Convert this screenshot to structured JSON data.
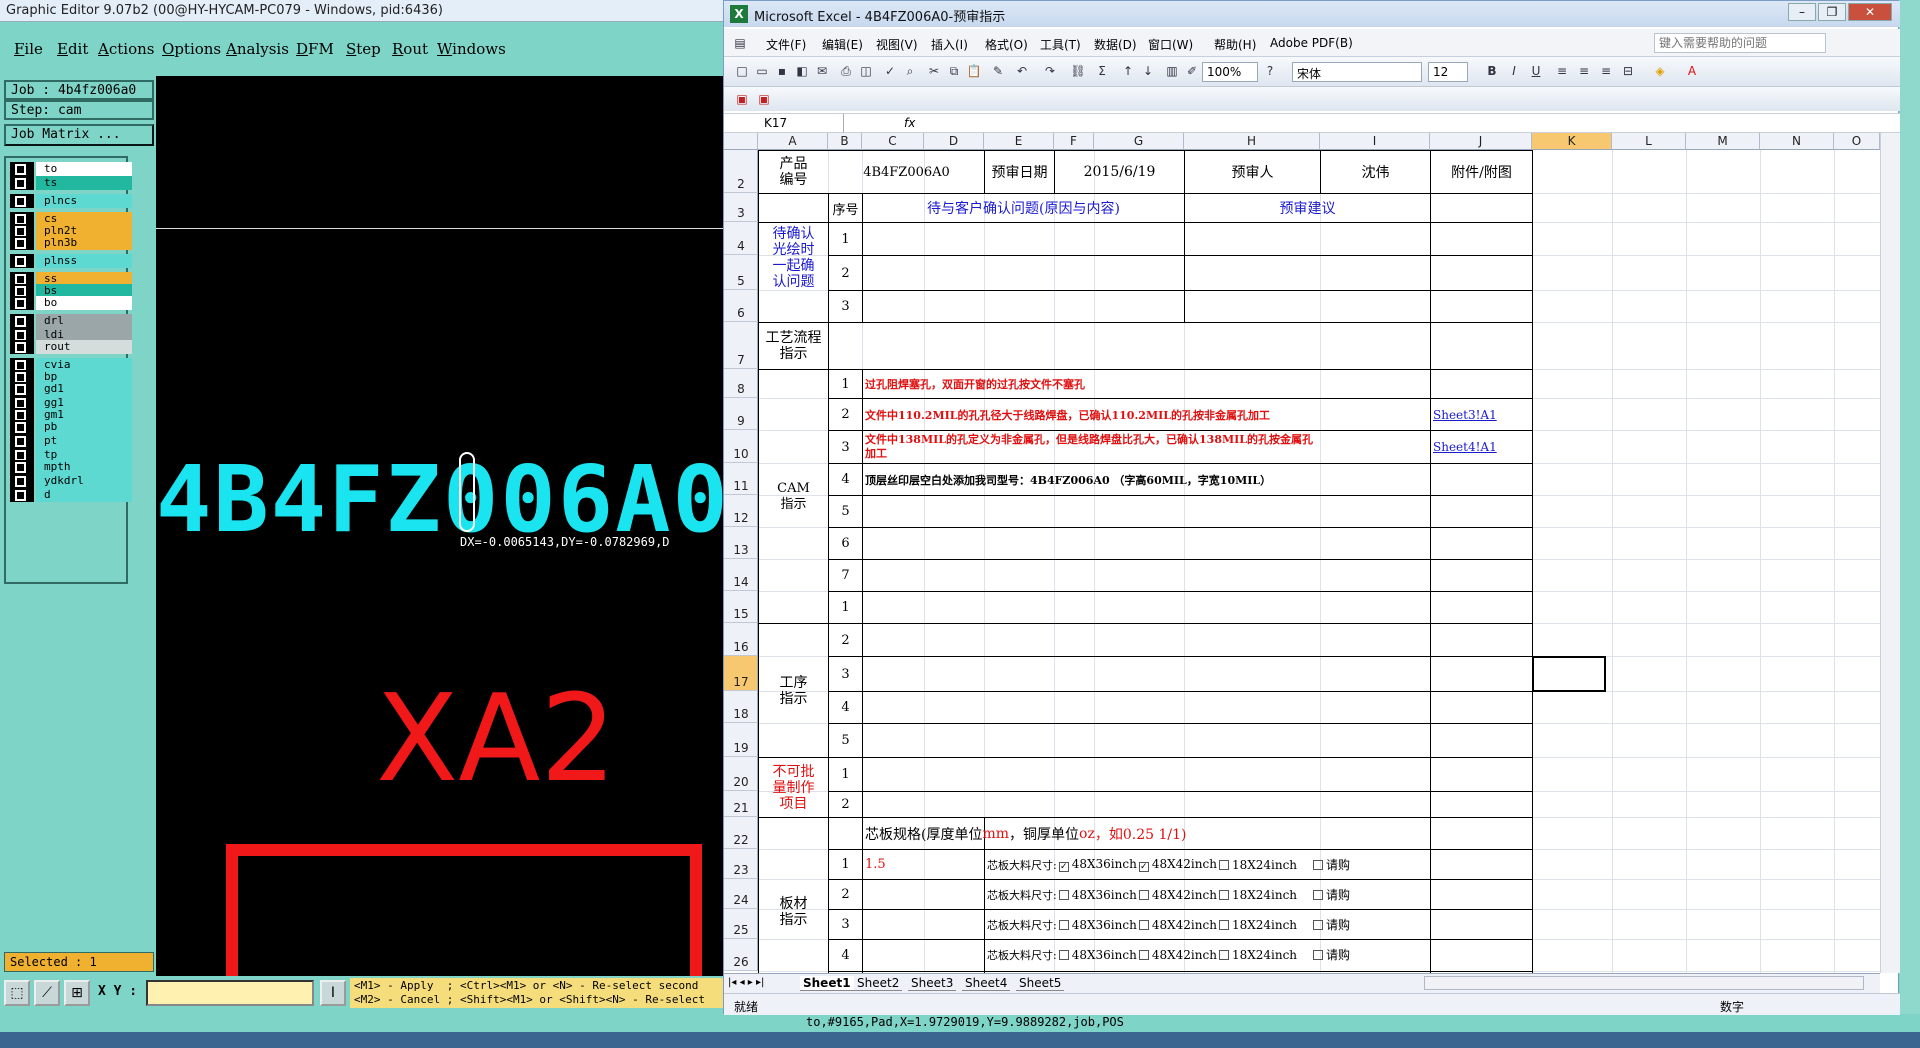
{
  "ge": {
    "title": "Graphic Editor 9.07b2 (00@HY-HYCAM-PC079 - Windows, pid:6436)",
    "menu": [
      "File",
      "Edit",
      "Actions",
      "Options",
      "Analysis",
      "DFM",
      "Step",
      "Rout",
      "Windows"
    ],
    "job": "Job : 4b4fz006a0",
    "step": "Step: cam",
    "job_matrix": "Job Matrix ...",
    "layers": [
      {
        "name": "to",
        "color": "white"
      },
      {
        "name": "ts",
        "color": "teal"
      },
      {
        "name": "plncs",
        "color": "cyan"
      },
      {
        "name": "cs",
        "color": "orange"
      },
      {
        "name": "pln2t",
        "color": "orange"
      },
      {
        "name": "pln3b",
        "color": "orange"
      },
      {
        "name": "plnss",
        "color": "cyan"
      },
      {
        "name": "ss",
        "color": "orange"
      },
      {
        "name": "bs",
        "color": "teal"
      },
      {
        "name": "bo",
        "color": "white"
      },
      {
        "name": "drl",
        "color": "gray"
      },
      {
        "name": "ldi",
        "color": "gray"
      },
      {
        "name": "rout",
        "color": "lgray"
      },
      {
        "name": "cvia",
        "color": "cyan"
      },
      {
        "name": "bp",
        "color": "cyan"
      },
      {
        "name": "gd1",
        "color": "cyan"
      },
      {
        "name": "gg1",
        "color": "cyan"
      },
      {
        "name": "gm1",
        "color": "cyan"
      },
      {
        "name": "pb",
        "color": "cyan"
      },
      {
        "name": "pt",
        "color": "cyan"
      },
      {
        "name": "tp",
        "color": "cyan"
      },
      {
        "name": "mpth",
        "color": "cyan"
      },
      {
        "name": "ydkdrl",
        "color": "cyan"
      },
      {
        "name": "d",
        "color": "cyan"
      }
    ],
    "canvas_text_cyan": "4B4FZ006A0",
    "canvas_coord": "DX=-0.0065143,DY=-0.0782969,D",
    "canvas_text_red": "XA2",
    "selected": "Selected : 1",
    "xy_label": "X Y :",
    "hint_line1": "<M1> - Apply  ; <Ctrl><M1> or <N> - Re-select second",
    "hint_line2": "<M2> - Cancel ; <Shift><M1> or <Shift><N> - Re-select",
    "status": "to,#9165,Pad,X=1.9729019,Y=9.9889282,job,POS"
  },
  "xl": {
    "title": "Microsoft Excel - 4B4FZ006A0-预审指示",
    "menu": [
      "文件(F)",
      "编辑(E)",
      "视图(V)",
      "插入(I)",
      "格式(O)",
      "工具(T)",
      "数据(D)",
      "窗口(W)",
      "帮助(H)",
      "Adobe PDF(B)"
    ],
    "help_placeholder": "键入需要帮助的问题",
    "zoom": "100%",
    "font": "宋体",
    "font_size": "12",
    "namebox": "K17",
    "fx": "fx",
    "columns": [
      "A",
      "B",
      "C",
      "D",
      "E",
      "F",
      "G",
      "H",
      "I",
      "J",
      "K",
      "L",
      "M",
      "N",
      "O"
    ],
    "rows": [
      "2",
      "3",
      "4",
      "5",
      "6",
      "7",
      "8",
      "9",
      "10",
      "11",
      "12",
      "13",
      "14",
      "15",
      "16",
      "17",
      "18",
      "19",
      "20",
      "21",
      "22",
      "23",
      "24",
      "25",
      "26"
    ],
    "sheet_tabs": [
      "Sheet1",
      "Sheet2",
      "Sheet3",
      "Sheet4",
      "Sheet5"
    ],
    "status_left": "就绪",
    "status_right": "数字",
    "cells": {
      "product_label": "产品\n编号",
      "product_no": "4B4FZ006A0",
      "review_date_label": "预审日期",
      "review_date": "2015/6/19",
      "reviewer_label": "预审人",
      "reviewer": "沈伟",
      "attachment_label": "附件/附图",
      "seq_label": "序号",
      "confirm_header": "待与客户确认问题(原因与内容)",
      "advice_header": "预审建议",
      "pending_label": "待确认\n光绘时\n一起确\n认问题",
      "process_label": "工艺流程\n指示",
      "cam_label": "CAM\n指示",
      "cam1": "过孔阻焊塞孔，双面开窗的过孔按文件不塞孔",
      "cam2": "文件中110.2MIL的孔孔径大于线路焊盘，已确认110.2MIL的孔按非金属孔加工",
      "cam2_link": "Sheet3!A1",
      "cam3a": "文件中138MIL的孔定义为非金属孔，但是线路焊盘比孔大，已确认138MIL的孔按金属孔",
      "cam3b": "加工",
      "cam3_link": "Sheet4!A1",
      "cam4": "顶层丝印层空白处添加我司型号：4B4FZ006A0 （字高60MIL，字宽10MIL）",
      "proc_label": "工序\n指示",
      "nobatch_label": "不可批\n量制作\n项目",
      "core_spec_a": "芯板规格(厚度单位",
      "core_spec_b": "mm",
      "core_spec_c": "，铜厚单位",
      "core_spec_d": "oz",
      "core_spec_e": "，如0.25 1/1)",
      "core1_value": "1.5",
      "material_label": "板材\n指示",
      "core_size_label": "芯板大料尺寸:",
      "opt1": "48X36inch",
      "opt2": "48X42inch",
      "opt3": "18X24inch",
      "opt4": "请购"
    }
  }
}
